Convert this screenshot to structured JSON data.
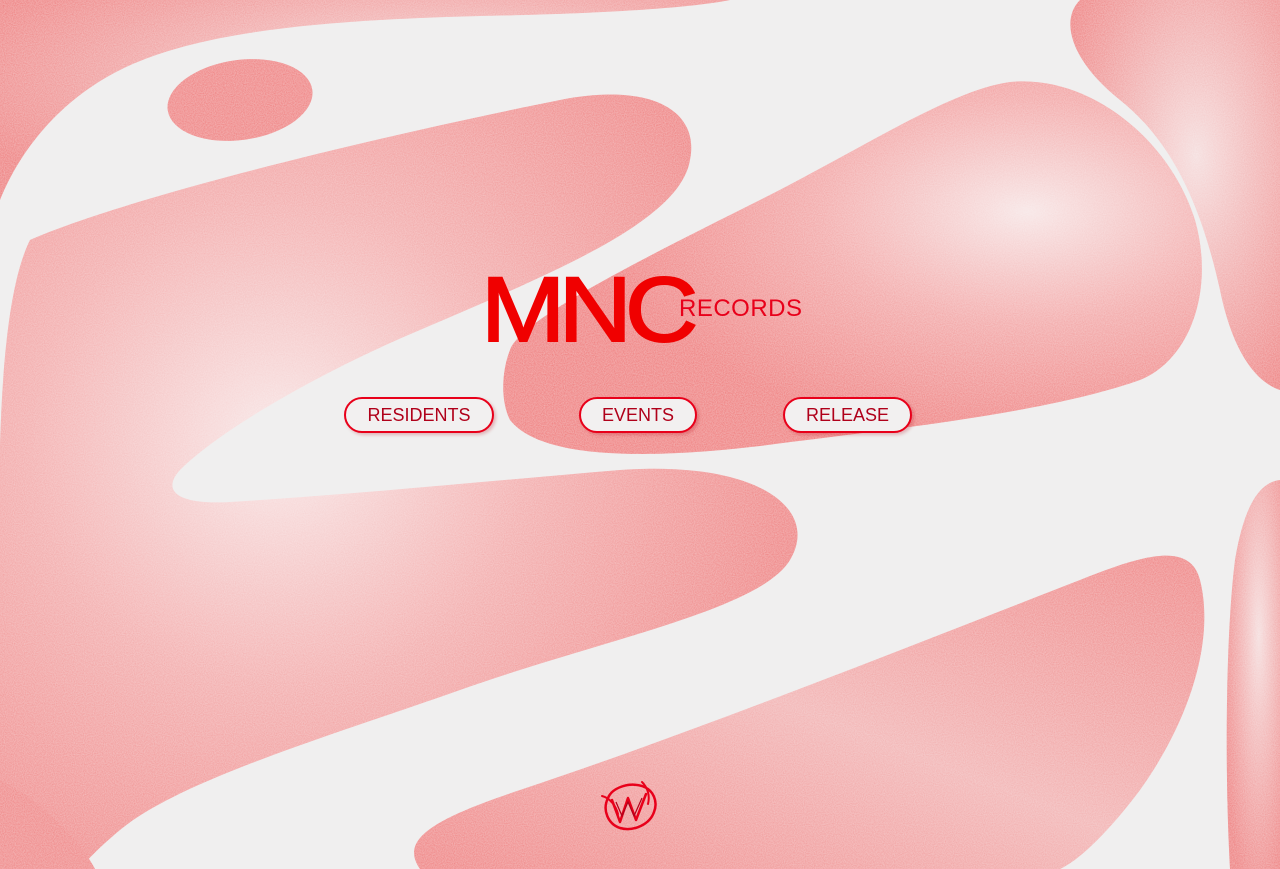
{
  "logo": {
    "main": "MNC",
    "sub": "RECORDS"
  },
  "nav": {
    "residents": "RESIDENTS",
    "events": "EVENTS",
    "release": "RELEASE"
  },
  "colors": {
    "accent": "#e8001a",
    "blob": "#f07878",
    "background": "#f0efef"
  },
  "icons": {
    "footer_emblem": "mnc-emblem-icon"
  }
}
